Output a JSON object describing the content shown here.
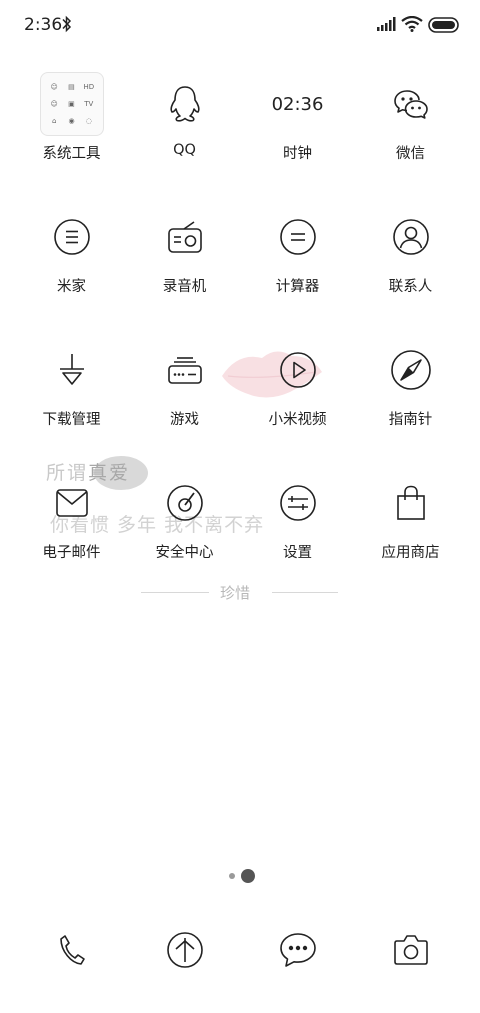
{
  "status_bar": {
    "time": "2:36"
  },
  "home": {
    "rows": [
      [
        {
          "label": "系统工具",
          "icon": "folder-icon",
          "name": "system-tools"
        },
        {
          "label": "QQ",
          "icon": "qq-penguin-icon",
          "name": "qq"
        },
        {
          "label": "时钟",
          "icon": "clock-icon",
          "name": "clock",
          "icon_text": "02:36"
        },
        {
          "label": "微信",
          "icon": "wechat-icon",
          "name": "wechat"
        }
      ],
      [
        {
          "label": "米家",
          "icon": "mijia-icon",
          "name": "mijia"
        },
        {
          "label": "录音机",
          "icon": "radio-icon",
          "name": "recorder"
        },
        {
          "label": "计算器",
          "icon": "calculator-icon",
          "name": "calculator"
        },
        {
          "label": "联系人",
          "icon": "contact-icon",
          "name": "contacts"
        }
      ],
      [
        {
          "label": "下载管理",
          "icon": "download-icon",
          "name": "downloads"
        },
        {
          "label": "游戏",
          "icon": "gamepad-icon",
          "name": "games"
        },
        {
          "label": "小米视频",
          "icon": "play-icon",
          "name": "mi-video"
        },
        {
          "label": "指南针",
          "icon": "compass-icon",
          "name": "compass"
        }
      ],
      [
        {
          "label": "电子邮件",
          "icon": "mail-icon",
          "name": "email"
        },
        {
          "label": "安全中心",
          "icon": "security-icon",
          "name": "security-center"
        },
        {
          "label": "设置",
          "icon": "settings-sliders-icon",
          "name": "settings"
        },
        {
          "label": "应用商店",
          "icon": "shopping-bag-icon",
          "name": "app-store"
        }
      ]
    ],
    "folder_tiny_labels": [
      "HD",
      "TV"
    ]
  },
  "wallpaper": {
    "line1_plain": "所谓",
    "line1_highlight": "真爱",
    "line2": "你看惯 多年 我不离不弃",
    "signature": "珍惜",
    "accent_color": "#f0b7bf"
  },
  "page_indicator": {
    "pages": 2,
    "current": 2
  },
  "dock": [
    {
      "icon": "phone-icon",
      "name": "phone"
    },
    {
      "icon": "browser-icon",
      "name": "browser"
    },
    {
      "icon": "message-icon",
      "name": "messages"
    },
    {
      "icon": "camera-icon",
      "name": "camera"
    }
  ]
}
